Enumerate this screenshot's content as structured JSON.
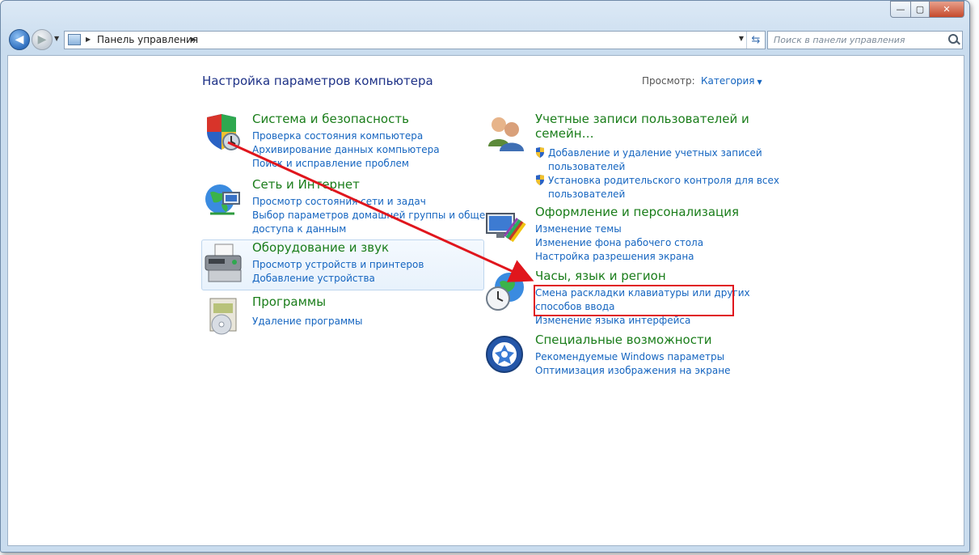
{
  "window": {
    "minimize_icon": "minimize-icon",
    "maximize_icon": "maximize-icon",
    "close_icon": "close-icon"
  },
  "nav": {
    "breadcrumb": "Панель управления",
    "search_placeholder": "Поиск в панели управления"
  },
  "main": {
    "title": "Настройка параметров компьютера",
    "view_label": "Просмотр:",
    "view_value": "Категория",
    "categories": [
      {
        "title": "Система и безопасность",
        "icon": "security-shield-icon",
        "links": [
          "Проверка состояния компьютера",
          "Архивирование данных компьютера",
          "Поиск и исправление проблем"
        ]
      },
      {
        "title": "Сеть и Интернет",
        "icon": "network-globe-icon",
        "links": [
          "Просмотр состояния сети и задач",
          "Выбор параметров домашней группы и общего",
          "доступа к данным"
        ]
      },
      {
        "title": "Оборудование и звук",
        "icon": "printer-icon",
        "links": [
          "Просмотр устройств и принтеров",
          "Добавление устройства"
        ]
      },
      {
        "title": "Программы",
        "icon": "programs-icon",
        "links": [
          "Удаление программы"
        ]
      },
      {
        "title_line1": "Учетные записи пользователей и",
        "title_line2": "семейн…",
        "icon": "users-icon",
        "links": [
          "Добавление и удаление учетных записей",
          "пользователей",
          "Установка родительского контроля для всех",
          "пользователей"
        ]
      },
      {
        "title": "Оформление и персонализация",
        "icon": "appearance-monitor-icon",
        "links": [
          "Изменение темы",
          "Изменение фона рабочего стола",
          "Настройка разрешения экрана"
        ]
      },
      {
        "title": "Часы, язык и регион",
        "icon": "clock-globe-icon",
        "links": [
          "Смена раскладки клавиатуры или других",
          "способов ввода",
          "Изменение языка интерфейса"
        ]
      },
      {
        "title": "Специальные возможности",
        "icon": "accessibility-icon",
        "links": [
          "Рекомендуемые Windows параметры",
          "Оптимизация изображения на экране"
        ]
      }
    ]
  },
  "colors": {
    "category_title": "#1a7d1a",
    "link": "#1565c0",
    "page_title": "#1e3287",
    "annotation_red": "#e0161d"
  }
}
